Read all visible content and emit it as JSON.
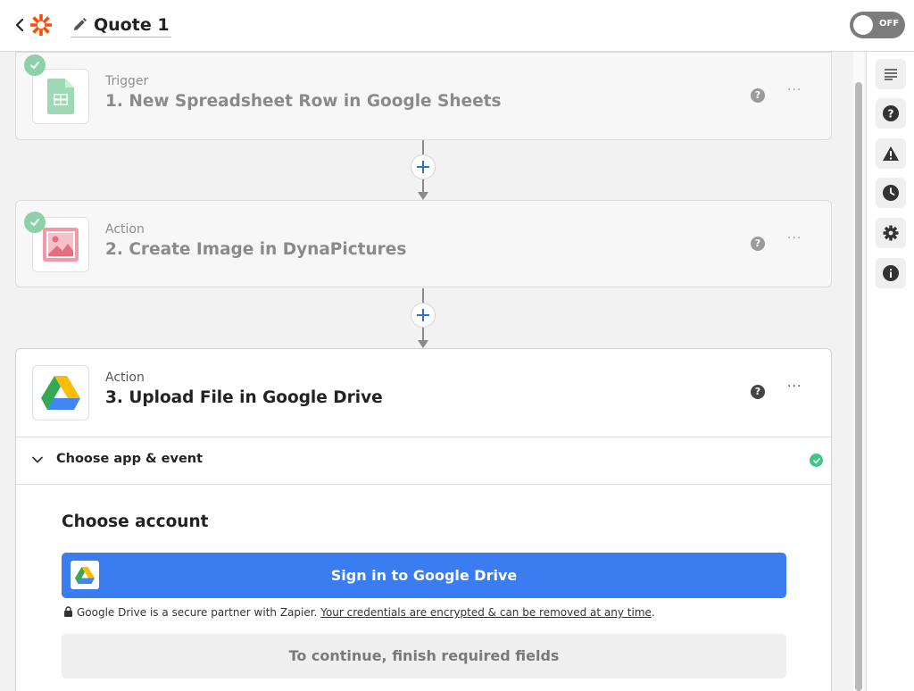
{
  "header": {
    "title": "Quote 1",
    "toggle_label": "OFF",
    "brand_color": "#ff4a00"
  },
  "steps": [
    {
      "kind": "Trigger",
      "name": "1. New Spreadsheet Row in Google Sheets",
      "app_icon": "google-sheets-icon",
      "status": "complete"
    },
    {
      "kind": "Action",
      "name": "2. Create Image in DynaPictures",
      "app_icon": "dynapictures-icon",
      "status": "complete"
    },
    {
      "kind": "Action",
      "name": "3. Upload File in Google Drive",
      "app_icon": "google-drive-icon",
      "status": "active"
    }
  ],
  "active_step": {
    "section_label": "Choose app & event",
    "panel_title": "Choose account",
    "signin_label": "Sign in to Google Drive",
    "secure_note": "Google Drive is a secure partner with Zapier.",
    "secure_link": "Your credentials are encrypted & can be removed at any time",
    "continue_label": "To continue, finish required fields"
  },
  "help_glyph": "?",
  "more_glyph": "···",
  "rail_icons": [
    "notes-icon",
    "help-icon",
    "alert-icon",
    "history-icon",
    "settings-icon",
    "info-icon"
  ],
  "colors": {
    "primary_button": "#3b7cf0",
    "success": "#3fc786",
    "complete_check": "#8dd1a9"
  }
}
